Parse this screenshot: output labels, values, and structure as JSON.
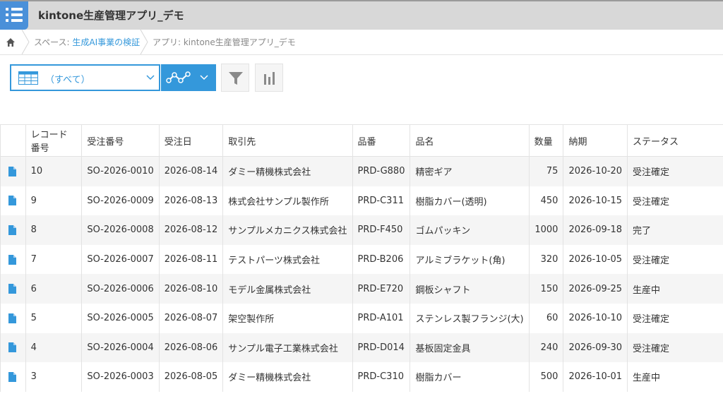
{
  "header": {
    "app_title": "kintone生産管理アプリ_デモ",
    "icon": "list-menu-icon"
  },
  "breadcrumb": {
    "home_icon": "home-icon",
    "space_prefix": "スペース: ",
    "space_name": "生成AI事業の検証",
    "app": "アプリ: kintone生産管理アプリ_デモ"
  },
  "toolbar": {
    "view_selected": "（すべて）",
    "view_icon": "table-view-icon",
    "graph_icon": "line-graph-icon",
    "filter_icon": "funnel-icon",
    "chart_icon": "bar-chart-icon"
  },
  "table": {
    "columns": [
      "",
      "レコード番号",
      "受注番号",
      "受注日",
      "取引先",
      "品番",
      "品名",
      "数量",
      "納期",
      "ステータス"
    ],
    "rows": [
      [
        "10",
        "SO-2026-0010",
        "2026-08-14",
        "ダミー精機株式会社",
        "PRD-G880",
        "精密ギア",
        "75",
        "2026-10-20",
        "受注確定"
      ],
      [
        "9",
        "SO-2026-0009",
        "2026-08-13",
        "株式会社サンプル製作所",
        "PRD-C311",
        "樹脂カバー(透明)",
        "450",
        "2026-10-15",
        "受注確定"
      ],
      [
        "8",
        "SO-2026-0008",
        "2026-08-12",
        "サンプルメカニクス株式会社",
        "PRD-F450",
        "ゴムパッキン",
        "1000",
        "2026-09-18",
        "完了"
      ],
      [
        "7",
        "SO-2026-0007",
        "2026-08-11",
        "テストパーツ株式会社",
        "PRD-B206",
        "アルミブラケット(角)",
        "320",
        "2026-10-05",
        "受注確定"
      ],
      [
        "6",
        "SO-2026-0006",
        "2026-08-10",
        "モデル金属株式会社",
        "PRD-E720",
        "鋼板シャフト",
        "150",
        "2026-09-25",
        "生産中"
      ],
      [
        "5",
        "SO-2026-0005",
        "2026-08-07",
        "架空製作所",
        "PRD-A101",
        "ステンレス製フランジ(大)",
        "60",
        "2026-10-10",
        "受注確定"
      ],
      [
        "4",
        "SO-2026-0004",
        "2026-08-06",
        "サンプル電子工業株式会社",
        "PRD-D014",
        "基板固定金具",
        "240",
        "2026-09-30",
        "受注確定"
      ],
      [
        "3",
        "SO-2026-0003",
        "2026-08-05",
        "ダミー精機株式会社",
        "PRD-C310",
        "樹脂カバー",
        "500",
        "2026-10-01",
        "生産中"
      ]
    ]
  },
  "colors": {
    "accent": "#3498db",
    "header_bg": "#d8d8d8",
    "row_alt": "#f5f5f5"
  }
}
